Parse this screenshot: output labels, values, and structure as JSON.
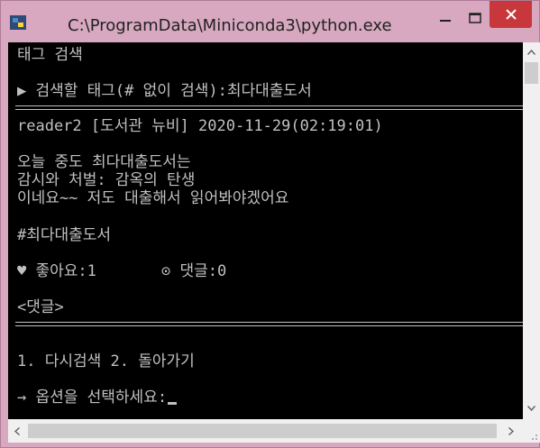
{
  "window": {
    "title": "C:\\ProgramData\\Miniconda3\\python.exe"
  },
  "console": {
    "lines": {
      "l1": "태그 검색",
      "l2": "▶ 검색할 태그(# 없이 검색):최다대출도서",
      "l3": "reader2 [도서관 뉴비]   2020-11-29(02:19:01)",
      "l4": "오늘 중도 최다대출도서는",
      "l5": "감시와 처벌: 감옥의 탄생",
      "l6": "이네요~~ 저도 대출해서 읽어봐야겠어요",
      "l7": "#최다대출도서",
      "l8_like": "♥ 좋아요:1",
      "l8_comment": "⊙ 댓글:0",
      "l9": "<댓글>",
      "l10": "1. 다시검색 2. 돌아가기",
      "l11": "→ 옵션을 선택하세요:"
    }
  },
  "colors": {
    "titlebar": "#d7a8bf",
    "close": "#c7373b",
    "console_bg": "#000000",
    "console_fg": "#c0c0c0"
  }
}
